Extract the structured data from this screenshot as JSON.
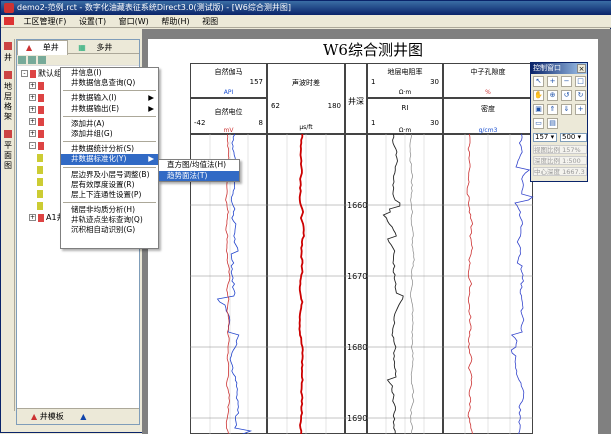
{
  "window": {
    "title": "demo2-范例.rct - 数字化油藏表征系统Direct3.0(测试版) - [W6综合测井图]"
  },
  "menubar": {
    "items": [
      "工区管理(F)",
      "设置(T)",
      "窗口(W)",
      "帮助(H)",
      "视图"
    ]
  },
  "left_strip": {
    "items": [
      "井",
      "地层格架",
      "平面图"
    ]
  },
  "left_panel": {
    "tabs": [
      "单井",
      "多井"
    ],
    "tree_root": "默认组",
    "tree_last": "A1井组",
    "bottom_label": "井模板",
    "bottom_arrow": "▲"
  },
  "context_menu": {
    "items": [
      {
        "label": "井信息(I)",
        "arrow": ""
      },
      {
        "label": "井数据信息查询(Q)",
        "arrow": ""
      },
      {
        "label": "井数据输入(I)",
        "arrow": "▶"
      },
      {
        "label": "井数据输出(E)",
        "arrow": "▶"
      },
      {
        "label": "添加井(A)",
        "arrow": ""
      },
      {
        "label": "添加井组(G)",
        "arrow": ""
      },
      {
        "label": "井数据统计分析(S)",
        "arrow": ""
      },
      {
        "label": "井数据标准化(Y)",
        "arrow": "▶"
      },
      {
        "label": "层边界及小层号调整(B)",
        "arrow": ""
      },
      {
        "label": "层有效厚度设置(R)",
        "arrow": ""
      },
      {
        "label": "层上下连通性设置(P)",
        "arrow": ""
      },
      {
        "label": "储层非均质分析(H)",
        "arrow": ""
      },
      {
        "label": "井轨迹点坐标查询(Q)",
        "arrow": ""
      },
      {
        "label": "沉积相自动识别(G)",
        "arrow": ""
      }
    ],
    "highlighted": "井数据标准化(Y)"
  },
  "submenu": {
    "items": [
      "直方图/均值法(H)",
      "趋势面法(T)"
    ],
    "highlighted": "趋势面法(T)"
  },
  "document": {
    "title": "W6综合测井图",
    "depth_header": "井深",
    "depth_ticks": [
      "1660",
      "1670",
      "1680",
      "1690"
    ],
    "track1": {
      "curve1": {
        "name": "自然伽马",
        "min": "",
        "max": "157",
        "unit": "API"
      },
      "curve2": {
        "name": "自然电位",
        "min": "-42",
        "max": "8",
        "unit": "mV"
      }
    },
    "track2": {
      "curve1": {
        "name": "声波时差",
        "min": "62",
        "max": "180",
        "unit": "μs/ft"
      }
    },
    "track3": {
      "curve1": {
        "name": "地层电阻率",
        "min": "1",
        "max": "30",
        "unit": "Ω·m"
      },
      "curve2": {
        "name": "RI",
        "min": "1",
        "max": "30",
        "unit": "Ω·m"
      }
    },
    "track4": {
      "curve1": {
        "name": "中子孔隙度",
        "min": "",
        "max": "",
        "unit": "%"
      },
      "curve2": {
        "name": "密度",
        "min": "",
        "max": "",
        "unit": "g/cm3"
      }
    }
  },
  "control_window": {
    "title": "控制窗口",
    "close": "×",
    "scale_value": "157",
    "scale_value2": "500",
    "info1": "视图比例 157%",
    "info2": "深度比例 1:500",
    "info3": "中心深度 1667.3"
  }
}
